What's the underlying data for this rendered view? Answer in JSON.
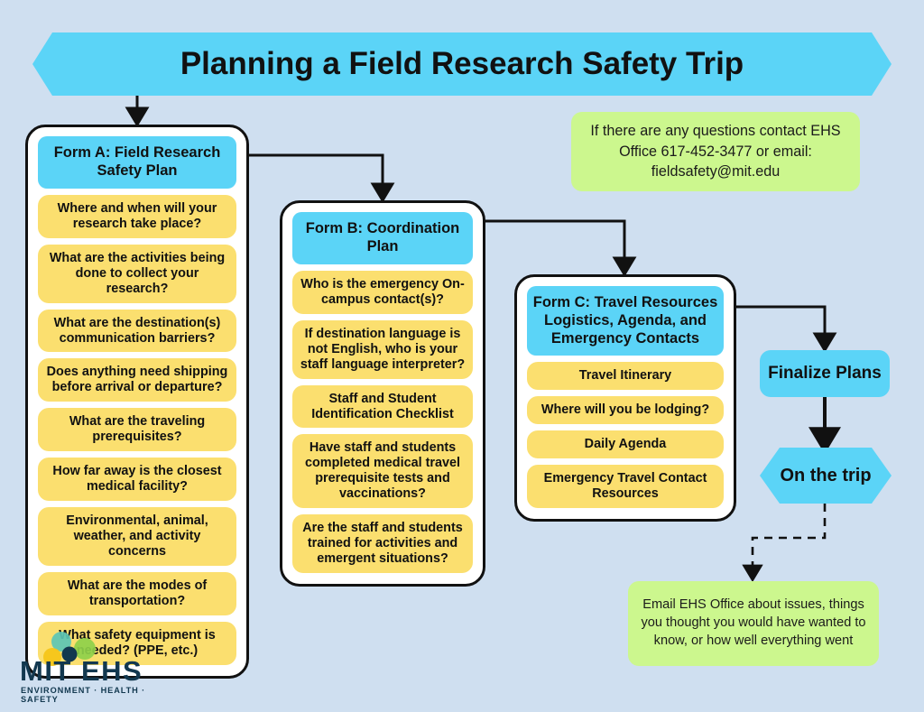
{
  "banner": {
    "title": "Planning a Field Research Safety Trip"
  },
  "colors": {
    "background": "#cfdff0",
    "accent_blue": "#5bd4f7",
    "pill_yellow": "#fbdf6f",
    "note_green": "#ccf78e",
    "outline": "#111111",
    "logo_navy": "#12384f"
  },
  "form_a": {
    "header": "Form A: Field Research Safety Plan",
    "items": [
      "Where and when will your research take place?",
      "What are the activities being done to collect your research?",
      "What are the destination(s) communication barriers?",
      "Does anything need shipping before arrival or departure?",
      "What are the traveling prerequisites?",
      "How far away is the closest medical facility?",
      "Environmental, animal, weather, and activity concerns",
      "What are the modes of transportation?",
      "What safety equipment is needed? (PPE, etc.)"
    ]
  },
  "form_b": {
    "header": "Form B: Coordination Plan",
    "items": [
      "Who is the emergency On-campus contact(s)?",
      "If destination language is not English, who is your staff language interpreter?",
      "Staff and Student Identification Checklist",
      "Have staff and students completed medical travel prerequisite tests and vaccinations?",
      "Are the staff and students trained for activities and emergent situations?"
    ]
  },
  "form_c": {
    "header": "Form C: Travel Resources Logistics, Agenda, and Emergency Contacts",
    "items": [
      "Travel Itinerary",
      "Where will you be lodging?",
      "Daily Agenda",
      "Emergency Travel Contact Resources"
    ]
  },
  "notes": {
    "contact": "If there are any questions contact EHS Office 617-452-3477 or email: fieldsafety@mit.edu",
    "followup": "Email EHS Office about issues, things you thought you would have wanted to know, or how well everything went"
  },
  "terminals": {
    "finalize": "Finalize Plans",
    "on_the_trip": "On the trip"
  },
  "logo": {
    "wordmark": "MIT EHS",
    "tagline": "ENVIRONMENT · HEALTH · SAFETY",
    "dot_colors": [
      "#5cc6b5",
      "#8ed04a",
      "#f5c518",
      "#12384f"
    ]
  }
}
